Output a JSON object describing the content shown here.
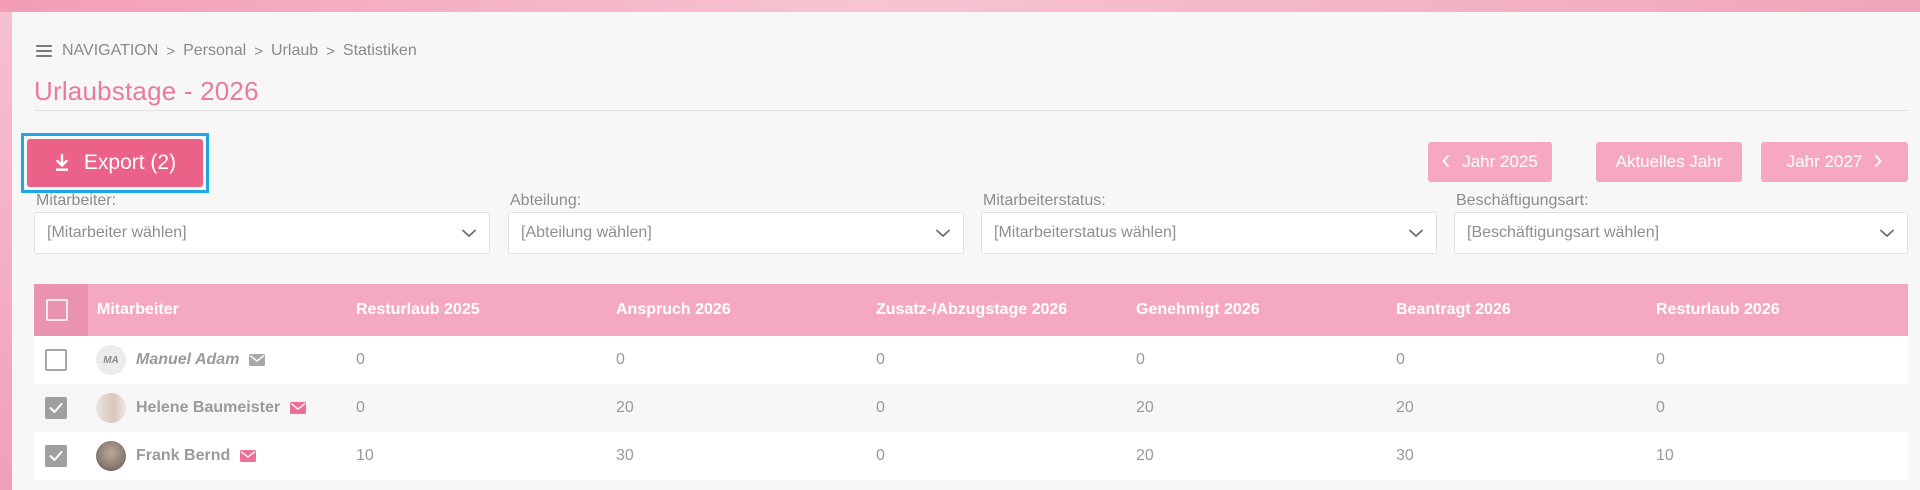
{
  "breadcrumb": {
    "menu_icon": "hamburger-menu-icon",
    "items": [
      "NAVIGATION",
      "Personal",
      "Urlaub",
      "Statistiken"
    ],
    "separator": ">"
  },
  "page": {
    "title": "Urlaubstage - 2026"
  },
  "toolbar": {
    "export_label": "Export (2)",
    "export_icon": "download-icon",
    "prev_year_label": "Jahr 2025",
    "current_year_label": "Aktuelles Jahr",
    "next_year_label": "Jahr 2027"
  },
  "filters": [
    {
      "label": "Mitarbeiter:",
      "placeholder": "[Mitarbeiter wählen]"
    },
    {
      "label": "Abteilung:",
      "placeholder": "[Abteilung wählen]"
    },
    {
      "label": "Mitarbeiterstatus:",
      "placeholder": "[Mitarbeiterstatus wählen]"
    },
    {
      "label": "Beschäftigungsart:",
      "placeholder": "[Beschäftigungsart wählen]"
    }
  ],
  "table": {
    "columns": [
      "Mitarbeiter",
      "Resturlaub 2025",
      "Anspruch 2026",
      "Zusatz-/Abzugstage 2026",
      "Genehmigt 2026",
      "Beantragt 2026",
      "Resturlaub 2026"
    ],
    "rows": [
      {
        "checked": false,
        "avatar_initials": "MA",
        "name": "Manuel Adam",
        "mail_color": "#a8a8a8",
        "values": [
          "0",
          "0",
          "0",
          "0",
          "0",
          "0"
        ]
      },
      {
        "checked": true,
        "avatar_initials": "",
        "name": "Helene Baumeister",
        "mail_color": "#ec6f95",
        "values": [
          "0",
          "20",
          "0",
          "20",
          "20",
          "0"
        ]
      },
      {
        "checked": true,
        "avatar_initials": "",
        "name": "Frank Bernd",
        "mail_color": "#ec6f95",
        "values": [
          "10",
          "30",
          "0",
          "20",
          "30",
          "10"
        ]
      }
    ]
  },
  "colors": {
    "accent": "#ec6188",
    "title": "#ea7aa0",
    "header_bg": "#f5a9c1",
    "year_button": "#f5a8bf",
    "focus_outline": "#1ea7e6"
  }
}
